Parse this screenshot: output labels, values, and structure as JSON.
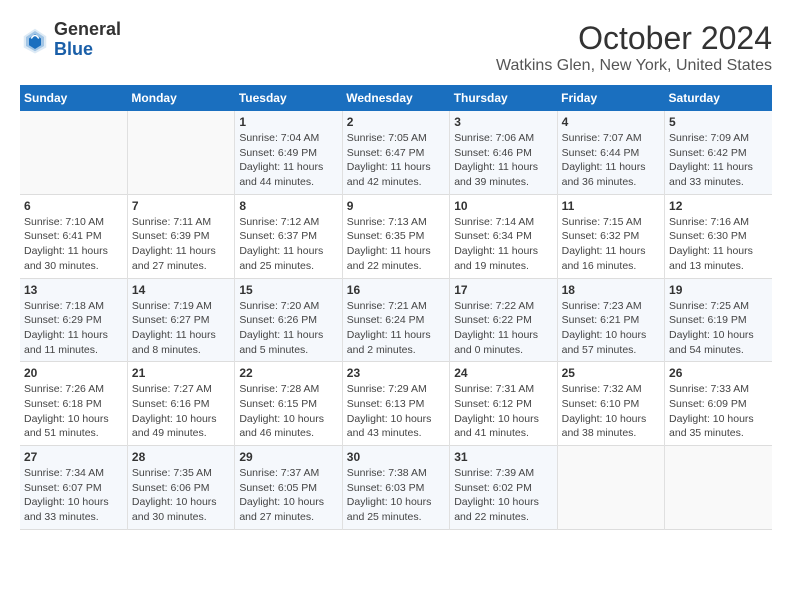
{
  "header": {
    "logo_line1": "General",
    "logo_line2": "Blue",
    "title": "October 2024",
    "subtitle": "Watkins Glen, New York, United States"
  },
  "columns": [
    "Sunday",
    "Monday",
    "Tuesday",
    "Wednesday",
    "Thursday",
    "Friday",
    "Saturday"
  ],
  "weeks": [
    [
      {
        "day": null,
        "info": null
      },
      {
        "day": null,
        "info": null
      },
      {
        "day": "1",
        "info": "Sunrise: 7:04 AM\nSunset: 6:49 PM\nDaylight: 11 hours and 44 minutes."
      },
      {
        "day": "2",
        "info": "Sunrise: 7:05 AM\nSunset: 6:47 PM\nDaylight: 11 hours and 42 minutes."
      },
      {
        "day": "3",
        "info": "Sunrise: 7:06 AM\nSunset: 6:46 PM\nDaylight: 11 hours and 39 minutes."
      },
      {
        "day": "4",
        "info": "Sunrise: 7:07 AM\nSunset: 6:44 PM\nDaylight: 11 hours and 36 minutes."
      },
      {
        "day": "5",
        "info": "Sunrise: 7:09 AM\nSunset: 6:42 PM\nDaylight: 11 hours and 33 minutes."
      }
    ],
    [
      {
        "day": "6",
        "info": "Sunrise: 7:10 AM\nSunset: 6:41 PM\nDaylight: 11 hours and 30 minutes."
      },
      {
        "day": "7",
        "info": "Sunrise: 7:11 AM\nSunset: 6:39 PM\nDaylight: 11 hours and 27 minutes."
      },
      {
        "day": "8",
        "info": "Sunrise: 7:12 AM\nSunset: 6:37 PM\nDaylight: 11 hours and 25 minutes."
      },
      {
        "day": "9",
        "info": "Sunrise: 7:13 AM\nSunset: 6:35 PM\nDaylight: 11 hours and 22 minutes."
      },
      {
        "day": "10",
        "info": "Sunrise: 7:14 AM\nSunset: 6:34 PM\nDaylight: 11 hours and 19 minutes."
      },
      {
        "day": "11",
        "info": "Sunrise: 7:15 AM\nSunset: 6:32 PM\nDaylight: 11 hours and 16 minutes."
      },
      {
        "day": "12",
        "info": "Sunrise: 7:16 AM\nSunset: 6:30 PM\nDaylight: 11 hours and 13 minutes."
      }
    ],
    [
      {
        "day": "13",
        "info": "Sunrise: 7:18 AM\nSunset: 6:29 PM\nDaylight: 11 hours and 11 minutes."
      },
      {
        "day": "14",
        "info": "Sunrise: 7:19 AM\nSunset: 6:27 PM\nDaylight: 11 hours and 8 minutes."
      },
      {
        "day": "15",
        "info": "Sunrise: 7:20 AM\nSunset: 6:26 PM\nDaylight: 11 hours and 5 minutes."
      },
      {
        "day": "16",
        "info": "Sunrise: 7:21 AM\nSunset: 6:24 PM\nDaylight: 11 hours and 2 minutes."
      },
      {
        "day": "17",
        "info": "Sunrise: 7:22 AM\nSunset: 6:22 PM\nDaylight: 11 hours and 0 minutes."
      },
      {
        "day": "18",
        "info": "Sunrise: 7:23 AM\nSunset: 6:21 PM\nDaylight: 10 hours and 57 minutes."
      },
      {
        "day": "19",
        "info": "Sunrise: 7:25 AM\nSunset: 6:19 PM\nDaylight: 10 hours and 54 minutes."
      }
    ],
    [
      {
        "day": "20",
        "info": "Sunrise: 7:26 AM\nSunset: 6:18 PM\nDaylight: 10 hours and 51 minutes."
      },
      {
        "day": "21",
        "info": "Sunrise: 7:27 AM\nSunset: 6:16 PM\nDaylight: 10 hours and 49 minutes."
      },
      {
        "day": "22",
        "info": "Sunrise: 7:28 AM\nSunset: 6:15 PM\nDaylight: 10 hours and 46 minutes."
      },
      {
        "day": "23",
        "info": "Sunrise: 7:29 AM\nSunset: 6:13 PM\nDaylight: 10 hours and 43 minutes."
      },
      {
        "day": "24",
        "info": "Sunrise: 7:31 AM\nSunset: 6:12 PM\nDaylight: 10 hours and 41 minutes."
      },
      {
        "day": "25",
        "info": "Sunrise: 7:32 AM\nSunset: 6:10 PM\nDaylight: 10 hours and 38 minutes."
      },
      {
        "day": "26",
        "info": "Sunrise: 7:33 AM\nSunset: 6:09 PM\nDaylight: 10 hours and 35 minutes."
      }
    ],
    [
      {
        "day": "27",
        "info": "Sunrise: 7:34 AM\nSunset: 6:07 PM\nDaylight: 10 hours and 33 minutes."
      },
      {
        "day": "28",
        "info": "Sunrise: 7:35 AM\nSunset: 6:06 PM\nDaylight: 10 hours and 30 minutes."
      },
      {
        "day": "29",
        "info": "Sunrise: 7:37 AM\nSunset: 6:05 PM\nDaylight: 10 hours and 27 minutes."
      },
      {
        "day": "30",
        "info": "Sunrise: 7:38 AM\nSunset: 6:03 PM\nDaylight: 10 hours and 25 minutes."
      },
      {
        "day": "31",
        "info": "Sunrise: 7:39 AM\nSunset: 6:02 PM\nDaylight: 10 hours and 22 minutes."
      },
      {
        "day": null,
        "info": null
      },
      {
        "day": null,
        "info": null
      }
    ]
  ]
}
